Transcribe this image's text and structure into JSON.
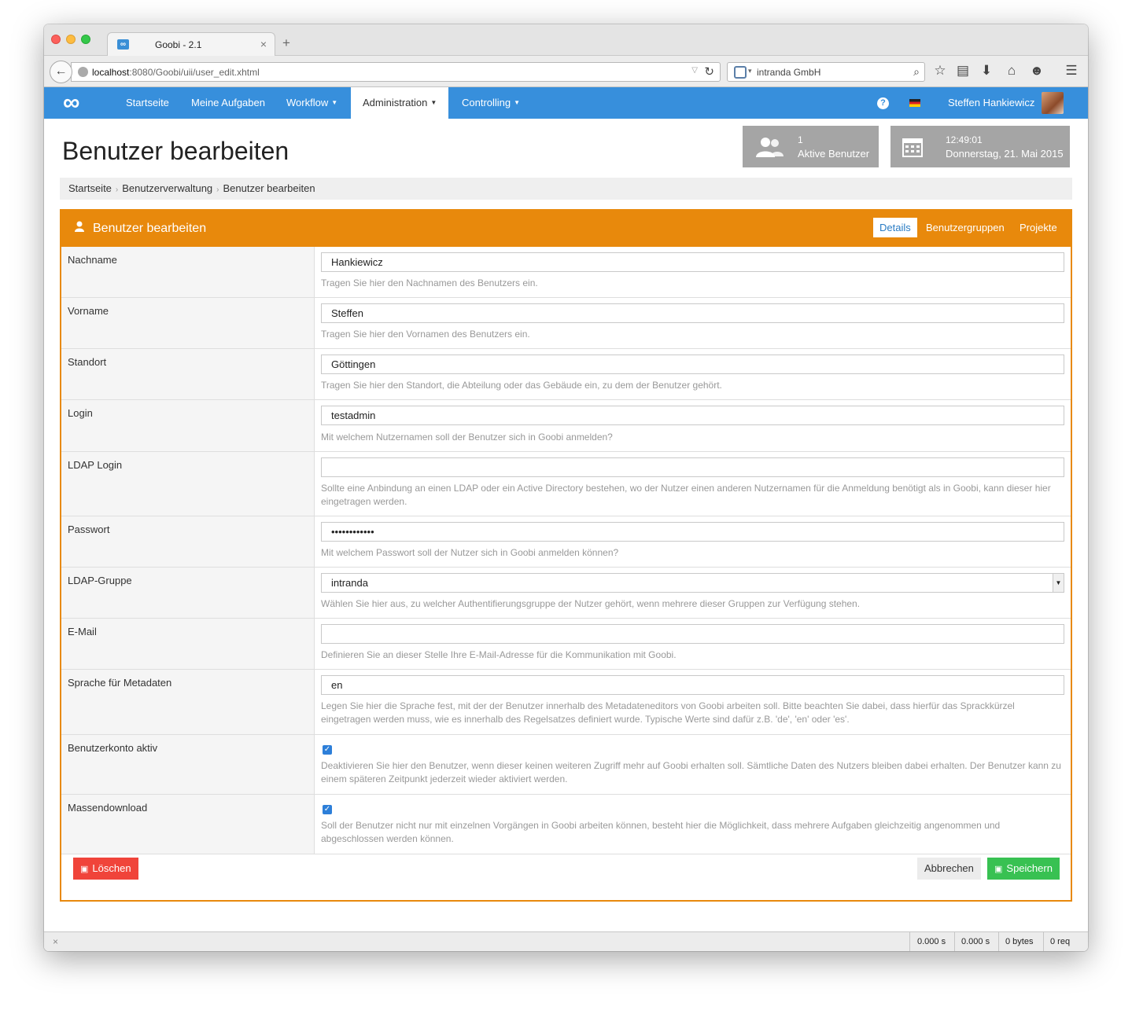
{
  "browser": {
    "tab_title": "Goobi - 2.1",
    "tab_favicon": "∞",
    "tab_close": "×",
    "new_tab": "+",
    "url_host": "localhost",
    "url_path": ":8080/Goobi/uii/user_edit.xhtml",
    "search_text": "intranda GmbH"
  },
  "navbar": {
    "logo": "∞",
    "items": [
      "Startseite",
      "Meine Aufgaben",
      "Workflow",
      "Administration",
      "Controlling"
    ],
    "active": "Administration",
    "help": "?",
    "user_name": "Steffen Hankiewicz"
  },
  "page": {
    "title": "Benutzer bearbeiten",
    "stats": {
      "active_users_count": "1",
      "active_users_label": "Aktive Benutzer",
      "time": "12:49:01",
      "date": "Donnerstag, 21. Mai 2015"
    },
    "breadcrumb": [
      "Startseite",
      "Benutzerverwaltung",
      "Benutzer bearbeiten"
    ]
  },
  "box": {
    "title": "Benutzer bearbeiten",
    "tabs": [
      "Details",
      "Benutzergruppen",
      "Projekte"
    ],
    "active_tab": "Details"
  },
  "form": {
    "nachname": {
      "label": "Nachname",
      "value": "Hankiewicz",
      "help": "Tragen Sie hier den Nachnamen des Benutzers ein."
    },
    "vorname": {
      "label": "Vorname",
      "value": "Steffen",
      "help": "Tragen Sie hier den Vornamen des Benutzers ein."
    },
    "standort": {
      "label": "Standort",
      "value": "Göttingen",
      "help": "Tragen Sie hier den Standort, die Abteilung oder das Gebäude ein, zu dem der Benutzer gehört."
    },
    "login": {
      "label": "Login",
      "value": "testadmin",
      "help": "Mit welchem Nutzernamen soll der Benutzer sich in Goobi anmelden?"
    },
    "ldap_login": {
      "label": "LDAP Login",
      "value": "",
      "help": "Sollte eine Anbindung an einen LDAP oder ein Active Directory bestehen, wo der Nutzer einen anderen Nutzernamen für die Anmeldung benötigt als in Goobi, kann dieser hier eingetragen werden."
    },
    "passwort": {
      "label": "Passwort",
      "value": "••••••••••••",
      "help": "Mit welchem Passwort soll der Nutzer sich in Goobi anmelden können?"
    },
    "ldap_gruppe": {
      "label": "LDAP-Gruppe",
      "value": "intranda",
      "help": "Wählen Sie hier aus, zu welcher Authentifierungsgruppe der Nutzer gehört, wenn mehrere dieser Gruppen zur Verfügung stehen."
    },
    "email": {
      "label": "E-Mail",
      "value": "",
      "help": "Definieren Sie an dieser Stelle Ihre E-Mail-Adresse für die Kommunikation mit Goobi."
    },
    "sprache": {
      "label": "Sprache für Metadaten",
      "value": "en",
      "help": "Legen Sie hier die Sprache fest, mit der der Benutzer innerhalb des Metadateneditors von Goobi arbeiten soll. Bitte beachten Sie dabei, dass hierfür das Sprackkürzel eingetragen werden muss, wie es innerhalb des Regelsatzes definiert wurde. Typische Werte sind dafür z.B. 'de', 'en' oder 'es'."
    },
    "konto_aktiv": {
      "label": "Benutzerkonto aktiv",
      "checked": true,
      "help": "Deaktivieren Sie hier den Benutzer, wenn dieser keinen weiteren Zugriff mehr auf Goobi erhalten soll. Sämtliche Daten des Nutzers bleiben dabei erhalten. Der Benutzer kann zu einem späteren Zeitpunkt jederzeit wieder aktiviert werden."
    },
    "massendownload": {
      "label": "Massendownload",
      "checked": true,
      "help": "Soll der Benutzer nicht nur mit einzelnen Vorgängen in Goobi arbeiten können, besteht hier die Möglichkeit, dass mehrere Aufgaben gleichzeitig angenommen und abgeschlossen werden können."
    }
  },
  "buttons": {
    "delete": "Löschen",
    "cancel": "Abbrechen",
    "save": "Speichern"
  },
  "statusbar": {
    "close": "×",
    "items": [
      "0.000 s",
      "0.000 s",
      "0 bytes",
      "0 req"
    ]
  },
  "colors": {
    "nav_blue": "#378fdc",
    "box_orange": "#e8890c",
    "delete_red": "#f0443a",
    "save_green": "#38c152"
  }
}
